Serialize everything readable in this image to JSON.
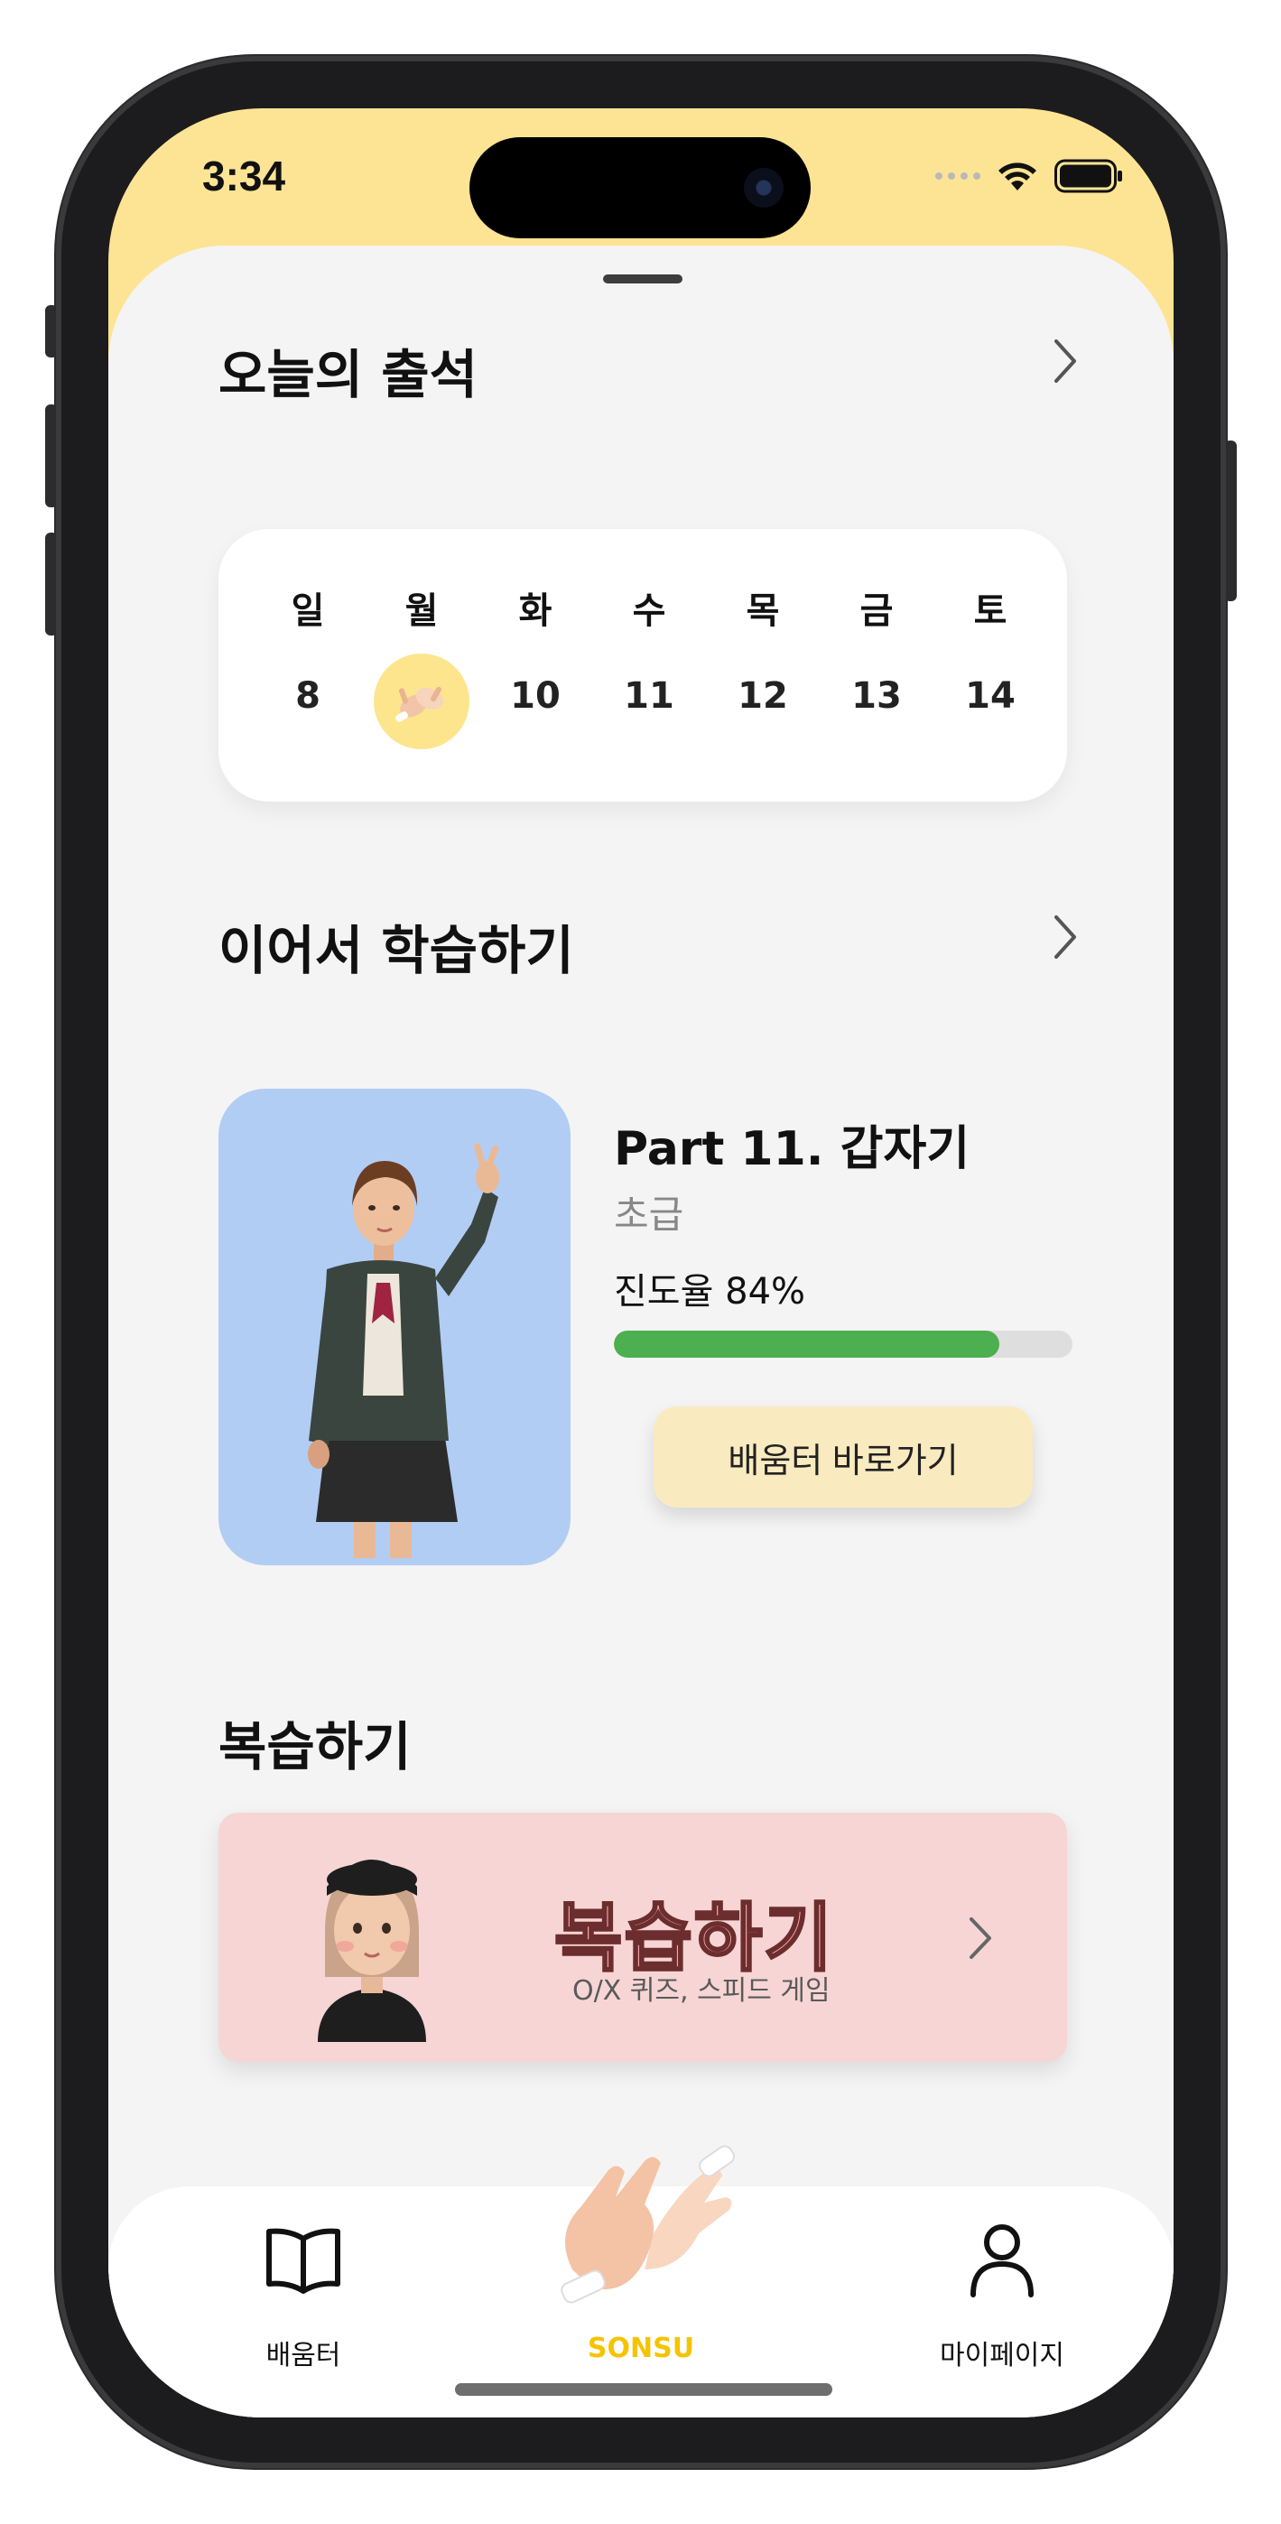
{
  "status_bar": {
    "time": "3:34"
  },
  "attendance": {
    "title": "오늘의 출석",
    "days": [
      {
        "day": "일",
        "date": "8"
      },
      {
        "day": "월",
        "date": ""
      },
      {
        "day": "화",
        "date": "10"
      },
      {
        "day": "수",
        "date": "11"
      },
      {
        "day": "목",
        "date": "12"
      },
      {
        "day": "금",
        "date": "13"
      },
      {
        "day": "토",
        "date": "14"
      }
    ],
    "checked_day_index": 1
  },
  "continue_learning": {
    "title": "이어서 학습하기",
    "part_title": "Part 11. 갑자기",
    "level": "초급",
    "progress_label": "진도율 84%",
    "progress": 0.84,
    "button_label": "배움터 바로가기"
  },
  "review": {
    "title": "복습하기",
    "banner_title": "복습하기",
    "banner_subtitle": "O/X 퀴즈, 스피드 게임"
  },
  "tabbar": {
    "items": [
      {
        "label": "배움터",
        "icon": "book-icon"
      },
      {
        "label": "SONSU",
        "icon": "sign-hands-icon"
      },
      {
        "label": "마이페이지",
        "icon": "person-icon"
      }
    ],
    "active_color": "#f5c400"
  },
  "colors": {
    "header_bg": "#fde494",
    "sheet_bg": "#f4f4f4",
    "progress": "#4caf50",
    "learn_image_bg": "#b2cdf3",
    "review_bg": "#f7d5d5"
  }
}
